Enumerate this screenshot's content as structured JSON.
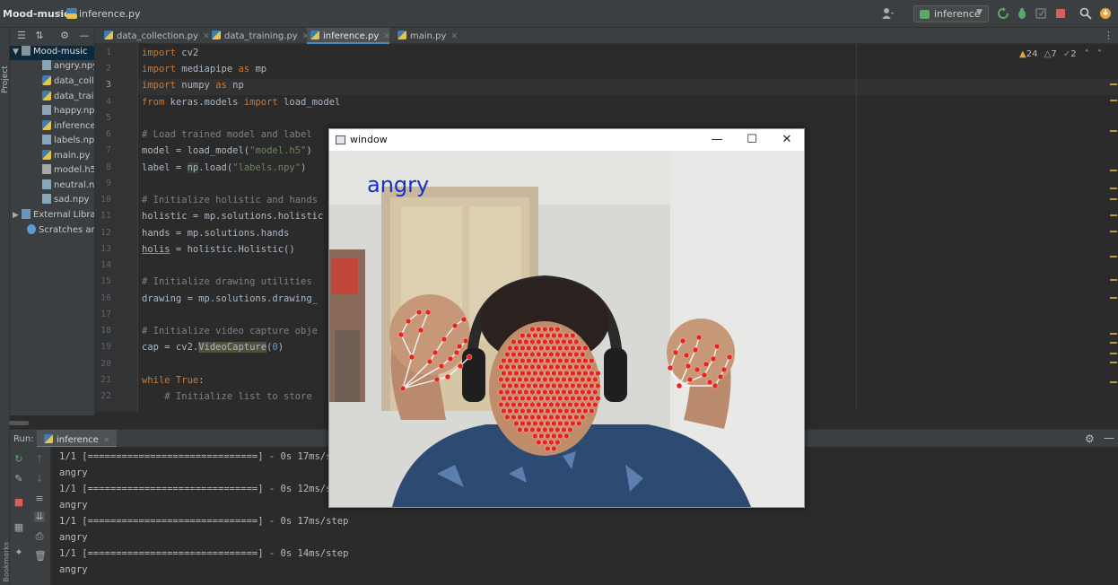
{
  "titlebar": {
    "project": "Mood-music",
    "file": "inference.py",
    "run_config": "inference"
  },
  "tool_strip": {
    "project_label": "Project",
    "bookmarks_label": "Bookmarks"
  },
  "project_tree": {
    "root": "Mood-music",
    "files": [
      "angry.npy",
      "data_colle",
      "data_train",
      "happy.npy",
      "inference.",
      "labels.npy",
      "main.py",
      "model.h5",
      "neutral.np",
      "sad.npy"
    ],
    "external": "External Libra",
    "scratches": "Scratches and"
  },
  "tabs": [
    "data_collection.py",
    "data_training.py",
    "inference.py",
    "main.py"
  ],
  "active_tab": "inference.py",
  "inspections": {
    "warnings": "24",
    "weak": "7",
    "ok": "2"
  },
  "editor": {
    "line_numbers": [
      "1",
      "2",
      "3",
      "4",
      "5",
      "6",
      "7",
      "8",
      "9",
      "10",
      "11",
      "12",
      "13",
      "14",
      "15",
      "16",
      "17",
      "18",
      "19",
      "20",
      "21",
      "22"
    ],
    "current_line": 3,
    "lines": {
      "l1_kw": "import",
      "l1_rest": " cv2",
      "l2_kw": "import",
      "l2_mod": " mediapipe ",
      "l2_as": "as",
      "l2_alias": " mp",
      "l3_kw": "import",
      "l3_mod": " numpy ",
      "l3_as": "as",
      "l3_alias": " np",
      "l4_kw1": "from",
      "l4_mod": " keras.models ",
      "l4_kw2": "import",
      "l4_rest": " load_model",
      "l6": "# Load trained model and label",
      "l7_a": "model = load_model(",
      "l7_str": "\"model.h5\"",
      "l7_b": ")",
      "l8_a": "label = ",
      "l8_hl": "np",
      "l8_b": ".load(",
      "l8_str": "\"labels.npy\"",
      "l8_c": ")",
      "l10": "# Initialize holistic and hands",
      "l11": "holistic = mp.solutions.holistic",
      "l12": "hands = mp.solutions.hands",
      "l13_a": "holis",
      "l13_b": " = holistic.Holistic()",
      "l15": "# Initialize drawing utilities",
      "l16": "drawing = mp.solutions.drawing_",
      "l18": "# Initialize video capture obje",
      "l19_a": "cap = cv2.",
      "l19_hl": "VideoCapture",
      "l19_b": "(",
      "l19_num": "0",
      "l19_c": ")",
      "l21_kw": "while",
      "l21_kw2": " True",
      "l21_rest": ":",
      "l22": "    # Initialize list to store"
    }
  },
  "run": {
    "label": "Run:",
    "tab": "inference",
    "console": [
      "1/1 [==============================] - 0s 17ms/step",
      "angry",
      "1/1 [==============================] - 0s 12ms/step",
      "angry",
      "1/1 [==============================] - 0s 17ms/step",
      "angry",
      "1/1 [==============================] - 0s 14ms/step",
      "angry"
    ]
  },
  "cv_window": {
    "title": "window",
    "prediction": "angry",
    "minimize": "—",
    "maximize": "☐",
    "close": "✕"
  },
  "colors": {
    "bg": "#2b2b2b",
    "panel": "#3c3f41",
    "keyword": "#cc7832",
    "comment": "#808080",
    "string": "#6a8759",
    "landmark": "#e8231c",
    "prediction_text": "#1a2fc4"
  }
}
